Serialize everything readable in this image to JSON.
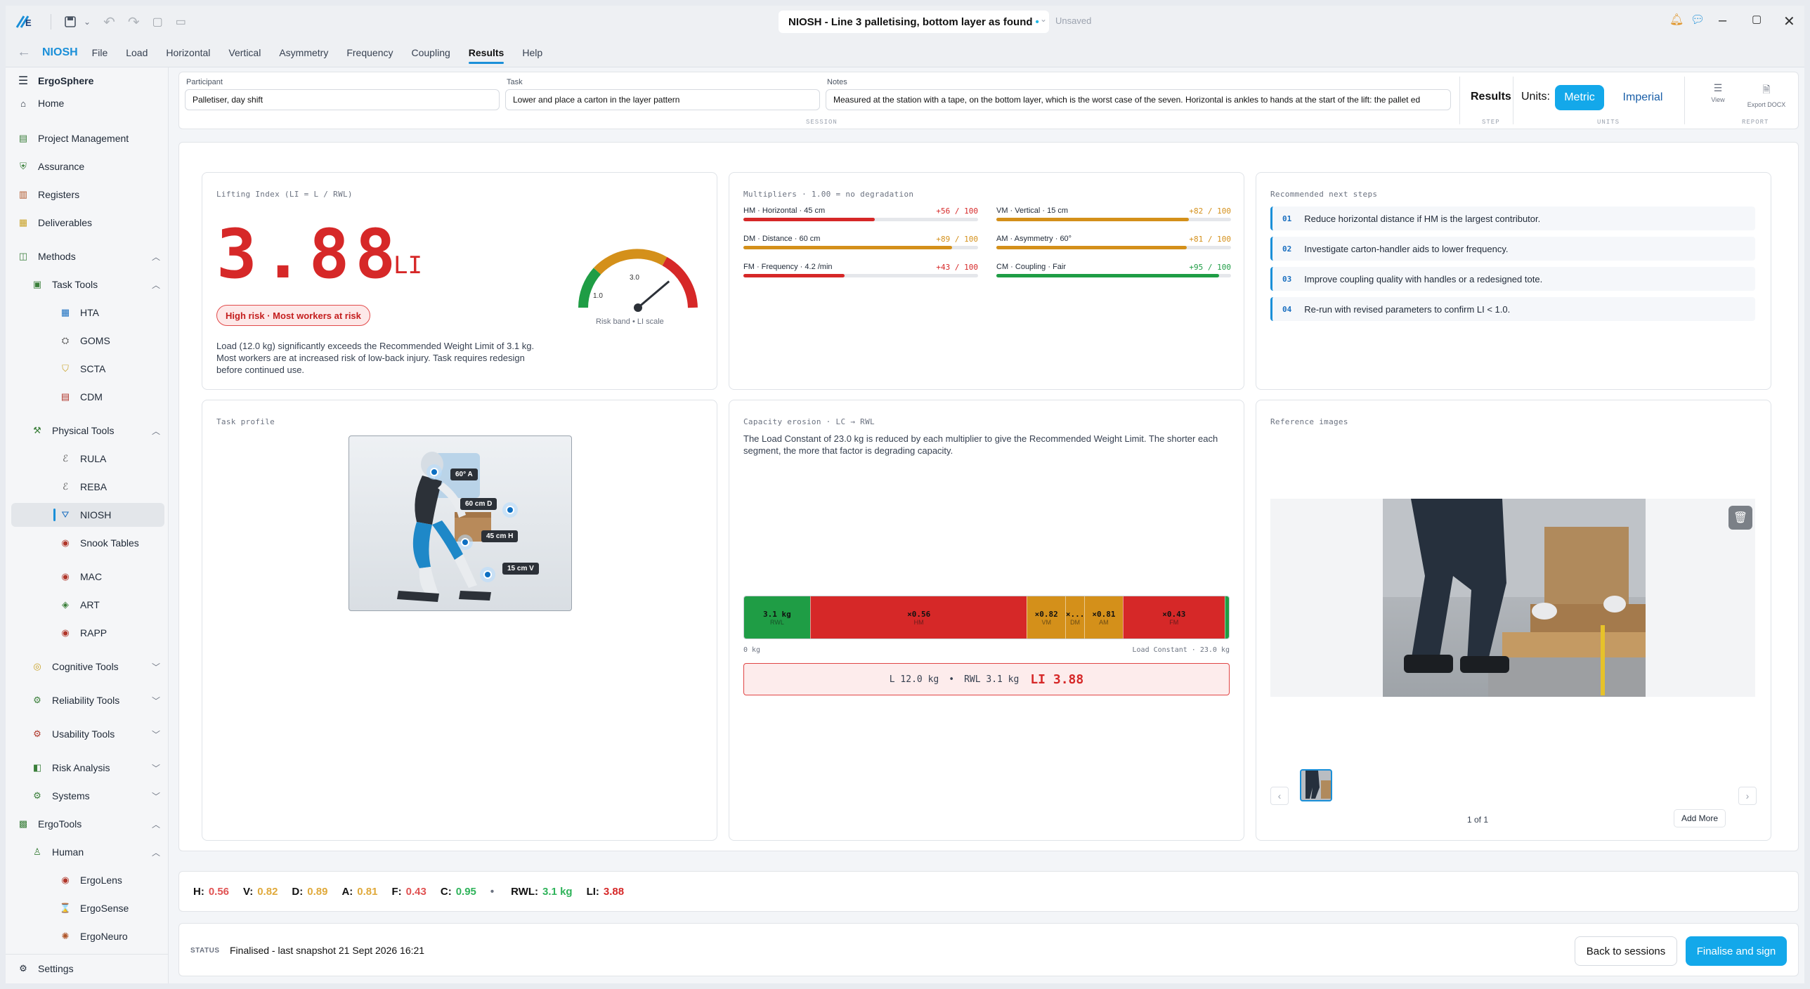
{
  "window": {
    "title": "NIOSH - Line 3 palletising, bottom layer as found",
    "dirty_marker": "•",
    "save_state": "Unsaved"
  },
  "menubar": {
    "brand": "NIOSH",
    "items": [
      "File",
      "Load",
      "Horizontal",
      "Vertical",
      "Asymmetry",
      "Frequency",
      "Coupling",
      "Results",
      "Help"
    ],
    "active": "Results"
  },
  "sidebar": {
    "app_name": "ErgoSphere",
    "home": "Home",
    "project_management": "Project Management",
    "assurance": "Assurance",
    "registers": "Registers",
    "deliverables": "Deliverables",
    "methods": "Methods",
    "task_tools": "Task Tools",
    "hta": "HTA",
    "goms": "GOMS",
    "scta": "SCTA",
    "cdm": "CDM",
    "physical_tools": "Physical Tools",
    "rula": "RULA",
    "reba": "REBA",
    "niosh": "NIOSH",
    "snook": "Snook Tables",
    "mac": "MAC",
    "art": "ART",
    "rapp": "RAPP",
    "cognitive": "Cognitive Tools",
    "reliability": "Reliability Tools",
    "usability": "Usability Tools",
    "risk": "Risk Analysis",
    "systems": "Systems",
    "ergotools": "ErgoTools",
    "human": "Human",
    "ergolens": "ErgoLens",
    "ergosense": "ErgoSense",
    "ergoneuro": "ErgoNeuro",
    "settings": "Settings"
  },
  "params": {
    "participant_label": "Participant",
    "participant": "Palletiser, day shift",
    "task_label": "Task",
    "task": "Lower and place a carton in the layer pattern",
    "notes_label": "Notes",
    "notes": "Measured at the station with a tape, on the bottom layer, which is the worst case of the seven. Horizontal is ankles to hands at the start of the lift: the pallet ed",
    "session_group": "SESSION",
    "step_title": "Results",
    "step_group": "STEP",
    "units_label": "Units:",
    "metric": "Metric",
    "imperial": "Imperial",
    "units_group": "UNITS",
    "view": "View",
    "export": "Export DOCX",
    "report_group": "REPORT"
  },
  "lifting": {
    "title": "Lifting Index (LI = L / RWL)",
    "value": "3.88",
    "unit": "LI",
    "badge": "High risk · Most workers at risk",
    "description": "Load (12.0 kg) significantly exceeds the Recommended Weight Limit of 3.1 kg. Most workers are at increased risk of low-back injury. Task requires redesign before continued use.",
    "gauge_low": "1.0",
    "gauge_mid": "3.0",
    "gauge_caption": "Risk band • LI scale",
    "gauge_value": 3.88
  },
  "multipliers": {
    "title": "Multipliers · 1.00 = no degradation",
    "rows": [
      {
        "label": "HM · Horizontal · 45 cm",
        "value": "+56 / 100",
        "pct": 56,
        "color": "#d62828"
      },
      {
        "label": "VM · Vertical · 15 cm",
        "value": "+82 / 100",
        "pct": 82,
        "color": "#d4901a"
      },
      {
        "label": "DM · Distance · 60 cm",
        "value": "+89 / 100",
        "pct": 89,
        "color": "#d4901a"
      },
      {
        "label": "AM · Asymmetry · 60°",
        "value": "+81 / 100",
        "pct": 81,
        "color": "#d4901a"
      },
      {
        "label": "FM · Frequency · 4.2 /min",
        "value": "+43 / 100",
        "pct": 43,
        "color": "#d62828"
      },
      {
        "label": "CM · Coupling · Fair",
        "value": "+95 / 100",
        "pct": 95,
        "color": "#1f9d45"
      }
    ]
  },
  "next_steps": {
    "title": "Recommended next steps",
    "items": [
      {
        "n": "01",
        "text": "Reduce horizontal distance if HM is the largest contributor."
      },
      {
        "n": "02",
        "text": "Investigate carton-handler aids to lower frequency."
      },
      {
        "n": "03",
        "text": "Improve coupling quality with handles or a redesigned tote."
      },
      {
        "n": "04",
        "text": "Re-run with revised parameters to confirm LI < 1.0."
      }
    ]
  },
  "task_profile": {
    "title": "Task profile",
    "tags": [
      "60° A",
      "60 cm D",
      "45 cm H",
      "15 cm V"
    ]
  },
  "capacity": {
    "title": "Capacity erosion · LC → RWL",
    "description": "The Load Constant of 23.0 kg is reduced by each multiplier to give the Recommended Weight Limit. The shorter each segment, the more that factor is degrading capacity.",
    "segments": [
      {
        "value": "3.1 kg",
        "label": "RWL",
        "color": "#1f9d45",
        "kg": 3.1
      },
      {
        "value": "×0.56",
        "label": "HM",
        "color": "#d62828",
        "kg": 10.2
      },
      {
        "value": "×0.82",
        "label": "VM",
        "color": "#d4901a",
        "kg": 1.8
      },
      {
        "value": "×...",
        "label": "DM",
        "color": "#d4901a",
        "kg": 0.9
      },
      {
        "value": "×0.81",
        "label": "AM",
        "color": "#d4901a",
        "kg": 1.8
      },
      {
        "value": "×0.43",
        "label": "FM",
        "color": "#d62828",
        "kg": 4.8
      },
      {
        "value": "",
        "label": "",
        "color": "#1f9d45",
        "kg": 0.2
      }
    ],
    "axis_zero": "0 kg",
    "axis_max": "Load Constant · 23.0 kg",
    "summary_l": "L 12.0 kg",
    "summary_sep": "•",
    "summary_rwl": "RWL 3.1 kg",
    "summary_li": "LI 3.88"
  },
  "reference": {
    "title": "Reference images",
    "pager": "1 of 1",
    "add_more": "Add More"
  },
  "summary": {
    "items": [
      {
        "k": "H:",
        "v": "0.56",
        "color": "#e05252"
      },
      {
        "k": "V:",
        "v": "0.82",
        "color": "#e0a93a"
      },
      {
        "k": "D:",
        "v": "0.89",
        "color": "#e0a93a"
      },
      {
        "k": "A:",
        "v": "0.81",
        "color": "#e0a93a"
      },
      {
        "k": "F:",
        "v": "0.43",
        "color": "#e05252"
      },
      {
        "k": "C:",
        "v": "0.95",
        "color": "#2fb35a"
      }
    ],
    "sep": "•",
    "rwl_k": "RWL:",
    "rwl_v": "3.1 kg",
    "li_k": "LI:",
    "li_v": "3.88"
  },
  "status": {
    "label": "STATUS",
    "text": "Finalised - last snapshot 21 Sept 2026 16:21",
    "back": "Back to sessions",
    "finalise": "Finalise and sign"
  }
}
